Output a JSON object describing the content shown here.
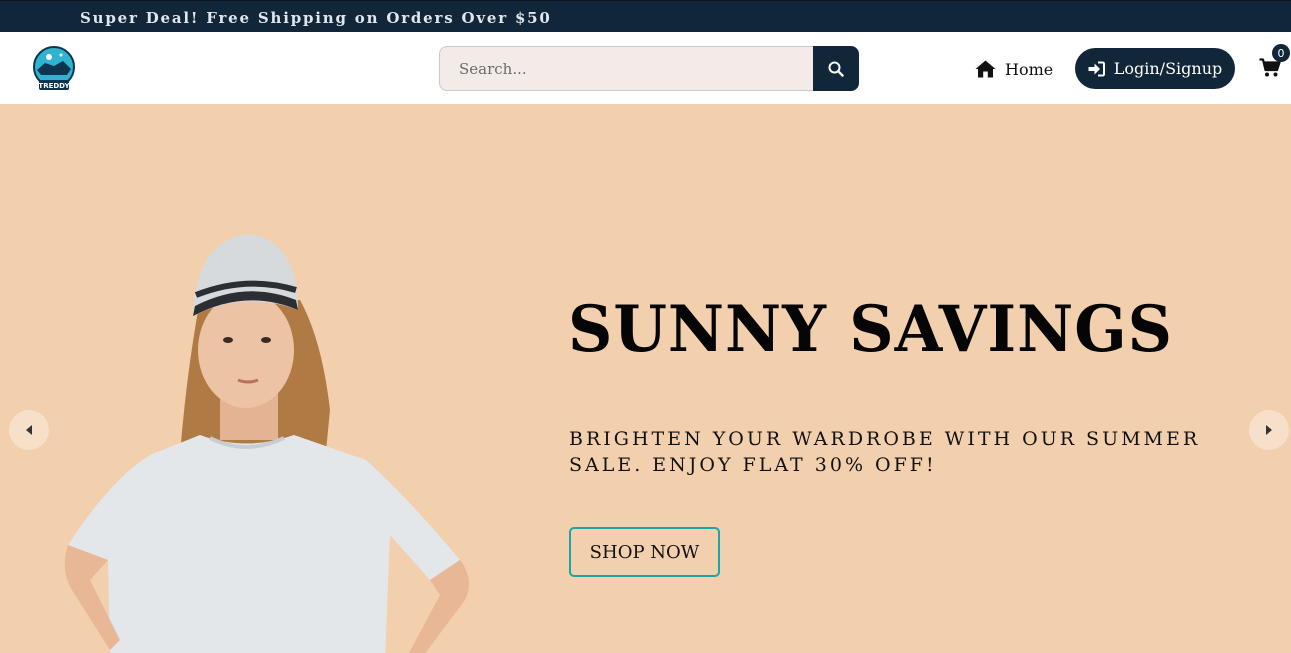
{
  "announcement": {
    "text": "Super Deal! Free Shipping on Orders Over $50"
  },
  "header": {
    "logo_text": "TREDDY",
    "search": {
      "placeholder": "Search...",
      "value": ""
    },
    "nav": {
      "home_label": "Home",
      "login_label": "Login/Signup"
    },
    "cart": {
      "count": "0"
    }
  },
  "hero": {
    "title": "SUNNY SAVINGS",
    "subtitle": "BRIGHTEN YOUR WARDROBE WITH OUR SUMMER SALE. ENJOY FLAT 30% OFF!",
    "cta_label": "SHOP NOW",
    "background_color": "#f2cfad"
  },
  "colors": {
    "navy": "#12263a",
    "accent_teal": "#1aa7a6",
    "search_bg": "#f3ebe8"
  },
  "icons": {
    "search": "search-icon",
    "home": "home-icon",
    "login": "sign-in-icon",
    "cart": "cart-icon",
    "prev": "caret-left-icon",
    "next": "caret-right-icon"
  }
}
